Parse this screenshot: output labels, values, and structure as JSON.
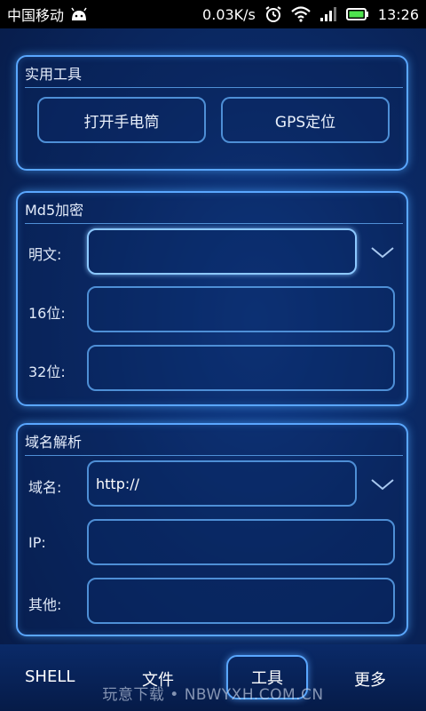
{
  "status_bar": {
    "carrier": "中国移动",
    "speed": "0.03K/s",
    "time": "13:26",
    "icons": [
      "android-icon",
      "alarm-icon",
      "wifi-icon",
      "signal-icon",
      "battery-icon"
    ]
  },
  "tools": {
    "title": "实用工具",
    "flashlight_label": "打开手电筒",
    "gps_label": "GPS定位"
  },
  "md5": {
    "title": "Md5加密",
    "plaintext_label": "明文:",
    "plaintext_value": "",
    "bit16_label": "16位:",
    "bit16_value": "",
    "bit32_label": "32位:",
    "bit32_value": ""
  },
  "dns": {
    "title": "域名解析",
    "domain_label": "域名:",
    "domain_value": "http://",
    "ip_label": "IP:",
    "ip_value": "",
    "other_label": "其他:",
    "other_value": ""
  },
  "nav": {
    "shell": "SHELL",
    "file": "文件",
    "tools": "工具",
    "more": "更多",
    "watermark": "玩意下载 • NBWYXH.COM.CN"
  },
  "colors": {
    "accent": "#5aa7ff",
    "background": "#0b2a66"
  }
}
